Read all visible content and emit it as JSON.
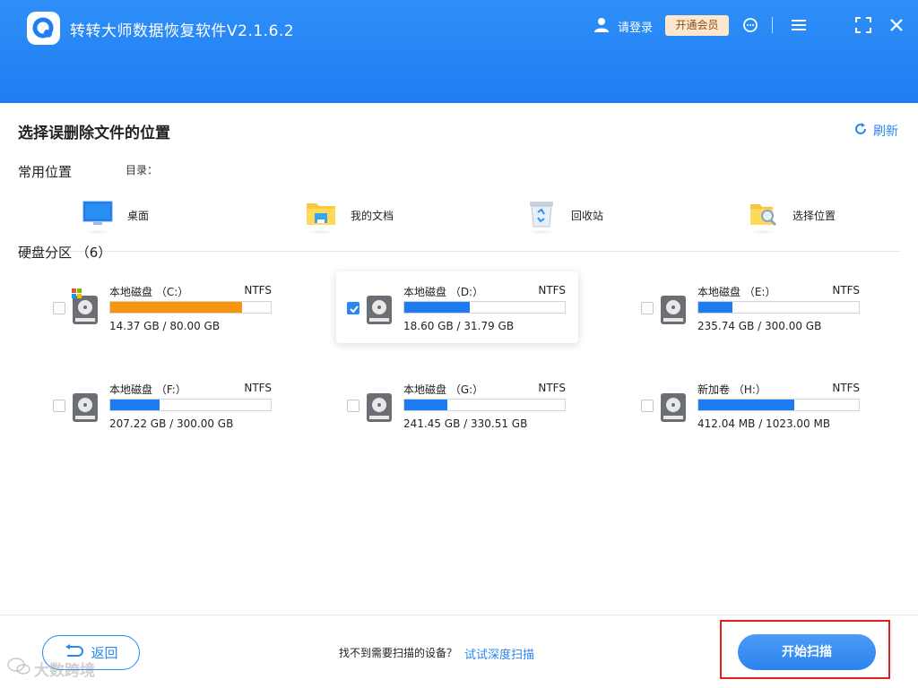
{
  "header": {
    "app_title": "转转大师数据恢复软件V2.1.6.2",
    "login_label": "请登录",
    "vip_label": "开通会员",
    "icons": [
      "user-icon",
      "support-icon",
      "menu-icon",
      "maximize-icon",
      "close-icon"
    ]
  },
  "main": {
    "title": "选择误删除文件的位置",
    "refresh_label": "刷新",
    "common_label": "常用位置",
    "dir_label": "目录：",
    "locations": [
      {
        "label": "桌面",
        "icon": "desktop-icon"
      },
      {
        "label": "我的文档",
        "icon": "documents-folder-icon"
      },
      {
        "label": "回收站",
        "icon": "recycle-bin-icon"
      },
      {
        "label": "选择位置",
        "icon": "choose-location-icon"
      }
    ],
    "disks_label": "硬盘分区 （6）",
    "disks": [
      {
        "name": "本地磁盘 （C:）",
        "fs": "NTFS",
        "size": "14.37 GB / 80.00 GB",
        "used_fraction": 0.82,
        "color": "#f7960c",
        "checked": false,
        "system": true
      },
      {
        "name": "本地磁盘 （D:）",
        "fs": "NTFS",
        "size": "18.60 GB / 31.79 GB",
        "used_fraction": 0.41,
        "color": "#1d7cf2",
        "checked": true,
        "system": false
      },
      {
        "name": "本地磁盘 （E:）",
        "fs": "NTFS",
        "size": "235.74 GB / 300.00 GB",
        "used_fraction": 0.21,
        "color": "#1d7cf2",
        "checked": false,
        "system": false
      },
      {
        "name": "本地磁盘 （F:）",
        "fs": "NTFS",
        "size": "207.22 GB / 300.00 GB",
        "used_fraction": 0.31,
        "color": "#1d7cf2",
        "checked": false,
        "system": false
      },
      {
        "name": "本地磁盘 （G:）",
        "fs": "NTFS",
        "size": "241.45 GB / 330.51 GB",
        "used_fraction": 0.27,
        "color": "#1d7cf2",
        "checked": false,
        "system": false
      },
      {
        "name": "新加卷 （H:）",
        "fs": "NTFS",
        "size": "412.04 MB / 1023.00 MB",
        "used_fraction": 0.6,
        "color": "#1d7cf2",
        "checked": false,
        "system": false
      }
    ]
  },
  "footer": {
    "back_label": "返回",
    "no_device_text": "找不到需要扫描的设备？",
    "deep_scan_label": "试试深度扫描",
    "start_label": "开始扫描",
    "watermark": "大数跨境"
  },
  "colors": {
    "accent": "#2a86f0",
    "header": "#1f7ef2",
    "system_disk": "#f7960c",
    "highlight": "#e02020"
  }
}
